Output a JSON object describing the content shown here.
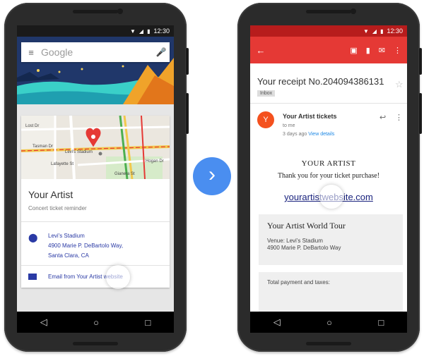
{
  "left_phone": {
    "status_time": "12:30",
    "search_placeholder": "Google",
    "map_labels": {
      "tasman": "Tasman Dr",
      "stadium": "Levi's Stadium",
      "hogan": "Hogan Dr",
      "gianera": "Gianera St",
      "lost": "Lost Dr",
      "lafayette": "Lafayette St"
    },
    "card_title": "Your Artist",
    "card_subtitle": "Concert ticket reminder",
    "venue_name": "Levi's Stadium",
    "venue_address_1": "4900 Marie P. DeBartolo Way,",
    "venue_address_2": "Santa Clara, CA",
    "email_link": "Email from Your Artist website"
  },
  "right_phone": {
    "status_time": "12:30",
    "subject": "Your receipt No.204094386131",
    "label": "Inbox",
    "avatar_letter": "Y",
    "sender": "Your Artist tickets",
    "to_me": "to me",
    "time_ago": "3 days ago",
    "view_details": "View details",
    "email_heading": "YOUR ARTIST",
    "thank_you": "Thank you for your ticket purchase!",
    "website_link": "yourartistwebsite.com",
    "tour_name": "Your Artist World Tour",
    "venue_line_1": "Venue: Levi's Stadium",
    "venue_line_2": "4900 Marie P. DeBartolo Way",
    "total_label": "Total payment and taxes:"
  },
  "colors": {
    "gmail_red": "#e53935",
    "arrow_blue": "#4a8ef0",
    "link_blue": "#2a3aa5",
    "avatar_orange": "#f4511e"
  }
}
